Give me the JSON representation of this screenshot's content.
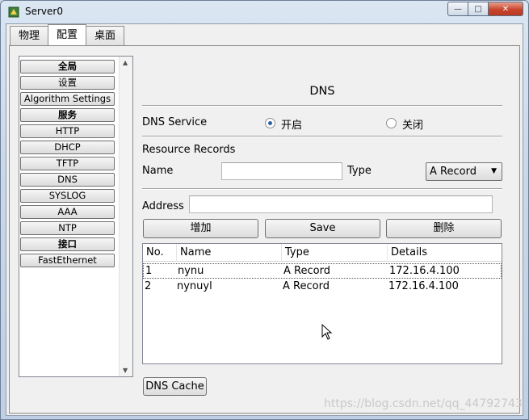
{
  "window": {
    "title": "Server0",
    "controls": {
      "minimize": "—",
      "maximize": "□",
      "close": "✕"
    }
  },
  "tabs": [
    {
      "label": "物理",
      "active": false
    },
    {
      "label": "配置",
      "active": true
    },
    {
      "label": "桌面",
      "active": false
    }
  ],
  "sidebar": {
    "items": [
      {
        "label": "全局",
        "section": true
      },
      {
        "label": "设置",
        "section": false
      },
      {
        "label": "Algorithm Settings",
        "section": false
      },
      {
        "label": "服务",
        "section": true
      },
      {
        "label": "HTTP",
        "section": false
      },
      {
        "label": "DHCP",
        "section": false
      },
      {
        "label": "TFTP",
        "section": false
      },
      {
        "label": "DNS",
        "section": false
      },
      {
        "label": "SYSLOG",
        "section": false
      },
      {
        "label": "AAA",
        "section": false
      },
      {
        "label": "NTP",
        "section": false
      },
      {
        "label": "接口",
        "section": true
      },
      {
        "label": "FastEthernet",
        "section": false
      }
    ]
  },
  "dns": {
    "title": "DNS",
    "service_label": "DNS Service",
    "on_label": "开启",
    "off_label": "关闭",
    "service_on": true,
    "resource_records_label": "Resource Records",
    "name_label": "Name",
    "name_value": "",
    "type_label": "Type",
    "type_value": "A Record",
    "address_label": "Address",
    "address_value": "",
    "add_button": "增加",
    "save_button": "Save",
    "delete_button": "删除",
    "table": {
      "columns": [
        "No.",
        "Name",
        "Type",
        "Details"
      ],
      "rows": [
        {
          "no": "1",
          "name": "nynu",
          "type": "A Record",
          "details": "172.16.4.100",
          "selected": true
        },
        {
          "no": "2",
          "name": "nynuyl",
          "type": "A Record",
          "details": "172.16.4.100",
          "selected": false
        }
      ]
    },
    "cache_button": "DNS Cache"
  },
  "watermark": "https://blog.csdn.net/qq_44792743"
}
